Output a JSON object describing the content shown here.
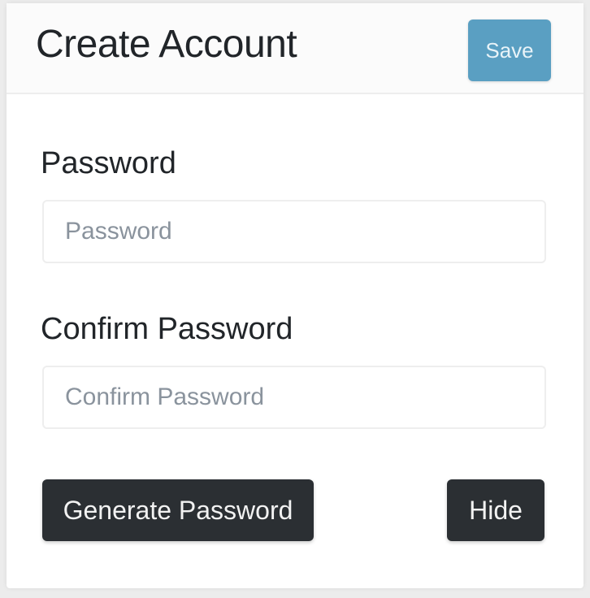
{
  "header": {
    "title": "Create Account",
    "save_label": "Save"
  },
  "form": {
    "password": {
      "label": "Password",
      "placeholder": "Password",
      "value": ""
    },
    "confirm_password": {
      "label": "Confirm Password",
      "placeholder": "Confirm Password",
      "value": ""
    }
  },
  "actions": {
    "generate_label": "Generate Password",
    "hide_label": "Hide"
  },
  "colors": {
    "save_button": "#5a9fc2",
    "dark_button": "#2b2f33",
    "background": "#ececec"
  }
}
